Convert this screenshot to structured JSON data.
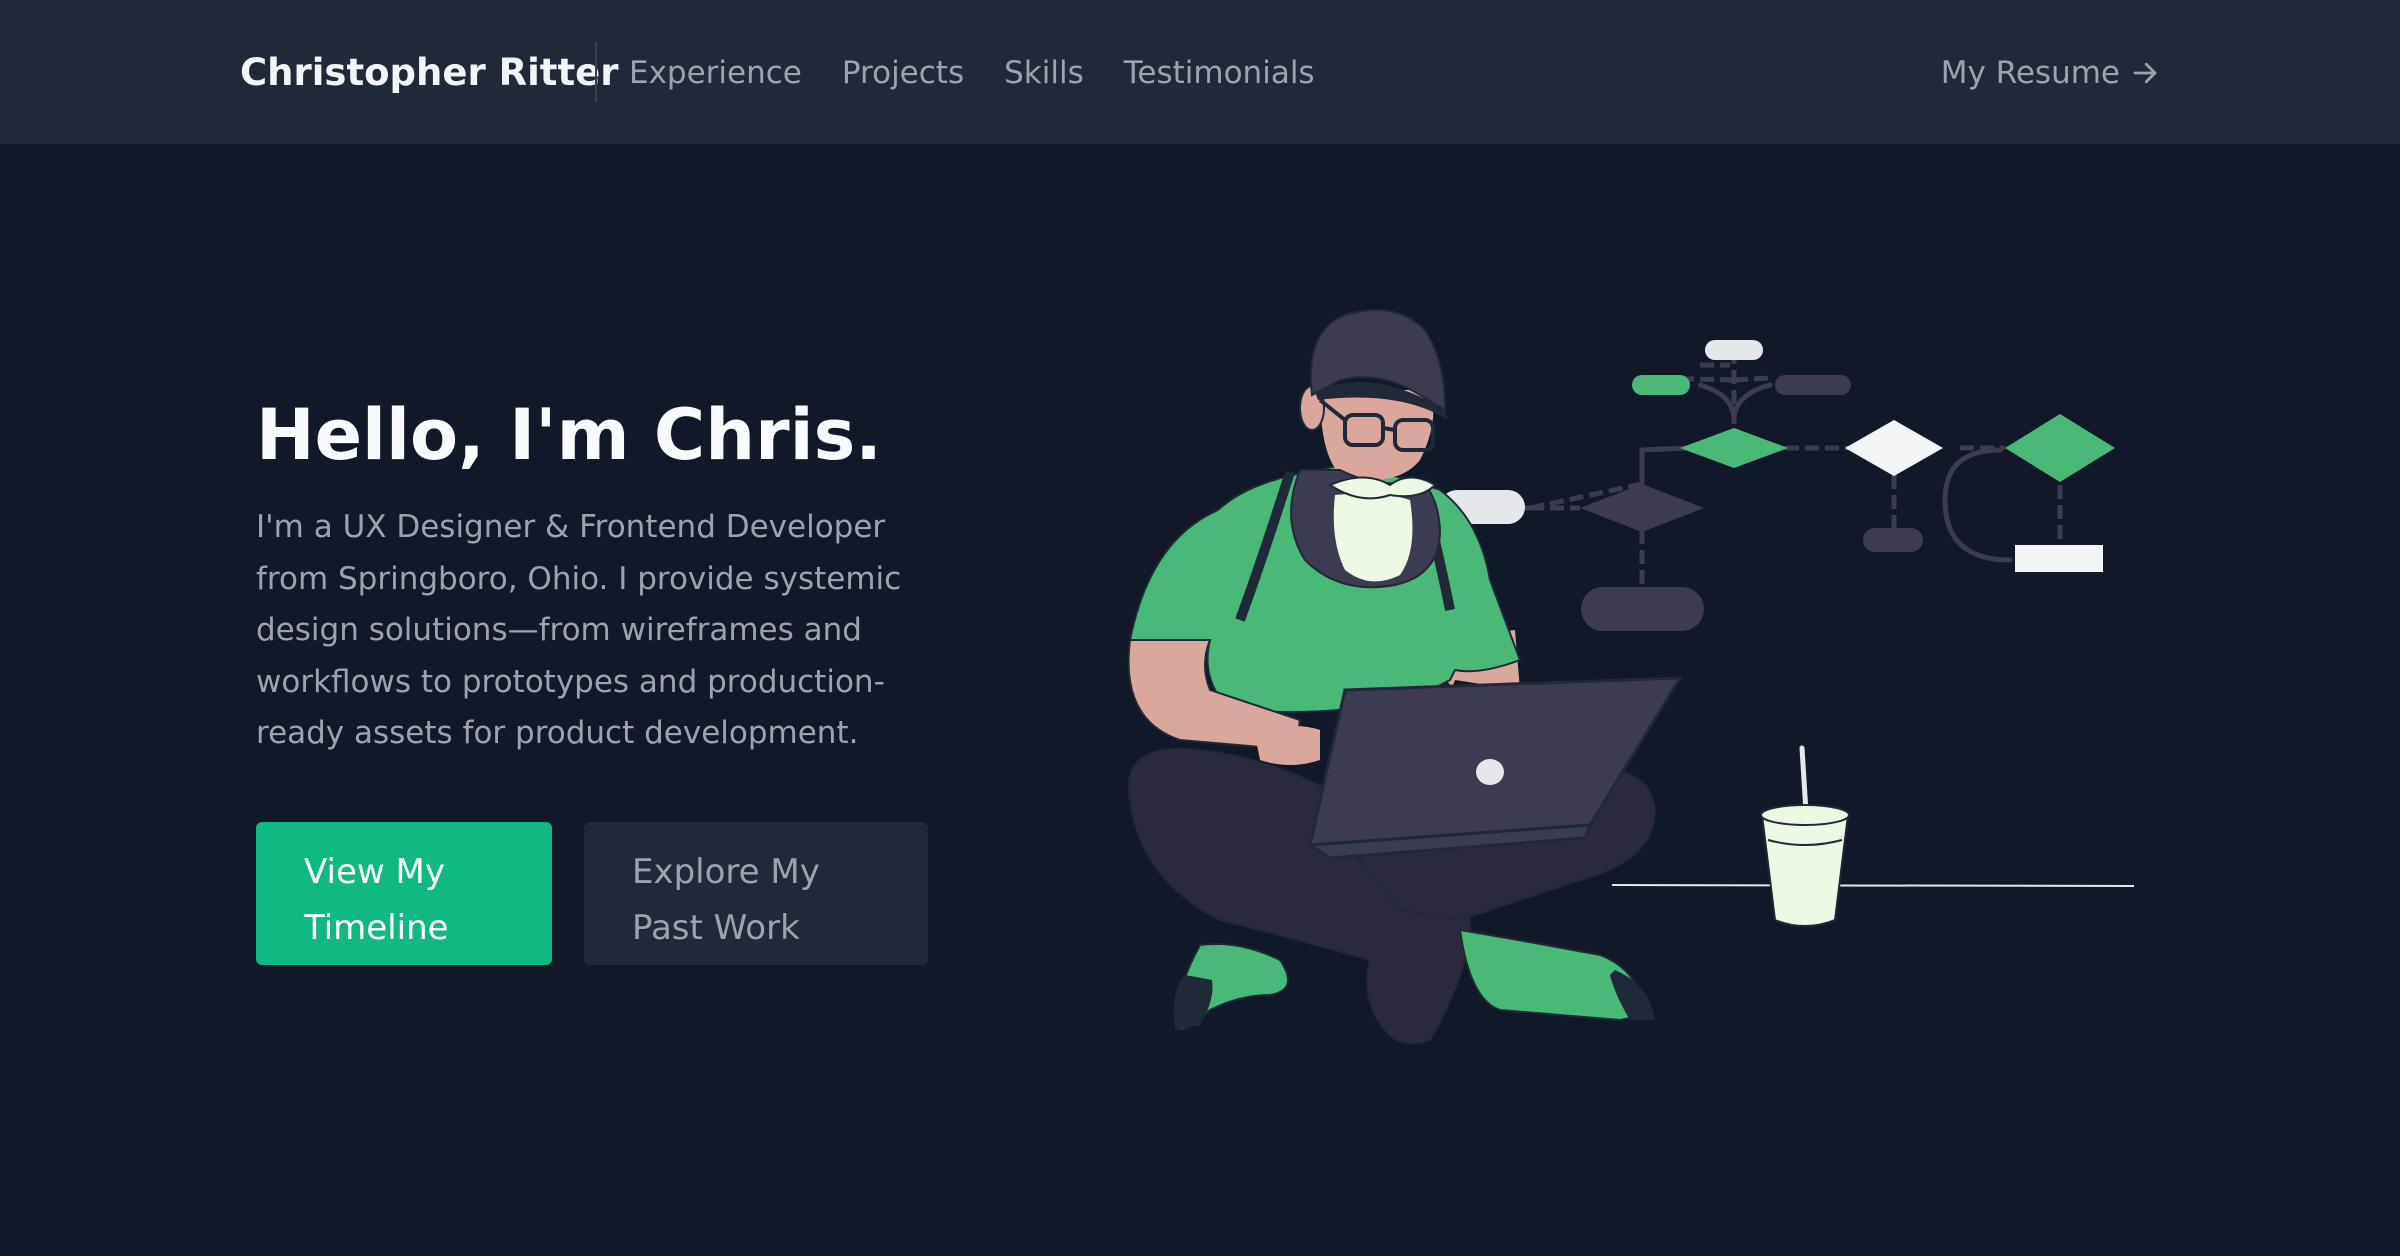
{
  "nav": {
    "brand": "Christopher Ritter",
    "links": [
      {
        "label": "Experience"
      },
      {
        "label": "Projects"
      },
      {
        "label": "Skills"
      },
      {
        "label": "Testimonials"
      }
    ],
    "resume_label": "My Resume"
  },
  "hero": {
    "title": "Hello, I'm Chris.",
    "description": "I'm a UX Designer & Frontend Developer from Springboro, Ohio. I provide systemic design solutions—from wireframes and workflows to prototypes and production-ready assets for product development.",
    "primary_button": "View My Timeline",
    "secondary_button": "Explore My Past Work"
  },
  "colors": {
    "background": "#111827",
    "navbar": "#1f2937",
    "accent": "#10b981",
    "illustration_green": "#4ab877",
    "illustration_dark": "#3d3b52"
  },
  "icons": {
    "resume": "arrow-right-icon"
  }
}
